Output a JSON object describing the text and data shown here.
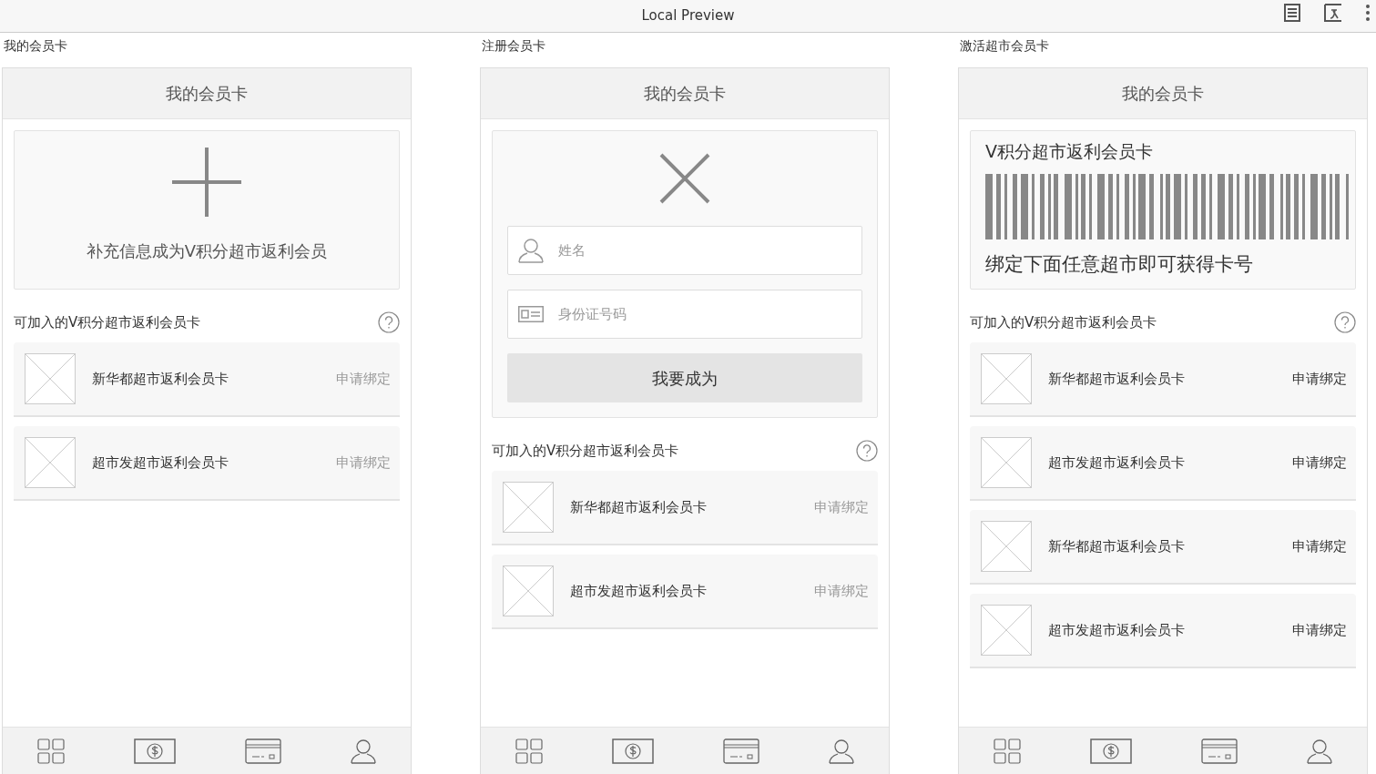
{
  "window": {
    "title": "Local Preview"
  },
  "screens": [
    {
      "caption": "我的会员卡",
      "header": "我的会员卡",
      "top_card": {
        "kind": "add",
        "text": "补充信息成为V积分超市返利会员"
      },
      "section_title": "可加入的V积分超市返利会员卡",
      "cards": [
        {
          "name": "新华都超市返利会员卡",
          "action": "申请绑定",
          "enabled": false
        },
        {
          "name": "超市发超市返利会员卡",
          "action": "申请绑定",
          "enabled": false
        }
      ]
    },
    {
      "caption": "注册会员卡",
      "header": "我的会员卡",
      "top_card": {
        "kind": "register",
        "name_placeholder": "姓名",
        "id_placeholder": "身份证号码",
        "button": "我要成为"
      },
      "section_title": "可加入的V积分超市返利会员卡",
      "cards": [
        {
          "name": "新华都超市返利会员卡",
          "action": "申请绑定",
          "enabled": false
        },
        {
          "name": "超市发超市返利会员卡",
          "action": "申请绑定",
          "enabled": false
        }
      ]
    },
    {
      "caption": "激活超市会员卡",
      "header": "我的会员卡",
      "top_card": {
        "kind": "barcode",
        "title": "V积分超市返利会员卡",
        "text": "绑定下面任意超市即可获得卡号"
      },
      "section_title": "可加入的V积分超市返利会员卡",
      "cards": [
        {
          "name": "新华都超市返利会员卡",
          "action": "申请绑定",
          "enabled": true
        },
        {
          "name": "超市发超市返利会员卡",
          "action": "申请绑定",
          "enabled": true
        },
        {
          "name": "新华都超市返利会员卡",
          "action": "申请绑定",
          "enabled": true
        },
        {
          "name": "超市发超市返利会员卡",
          "action": "申请绑定",
          "enabled": true
        }
      ]
    }
  ]
}
